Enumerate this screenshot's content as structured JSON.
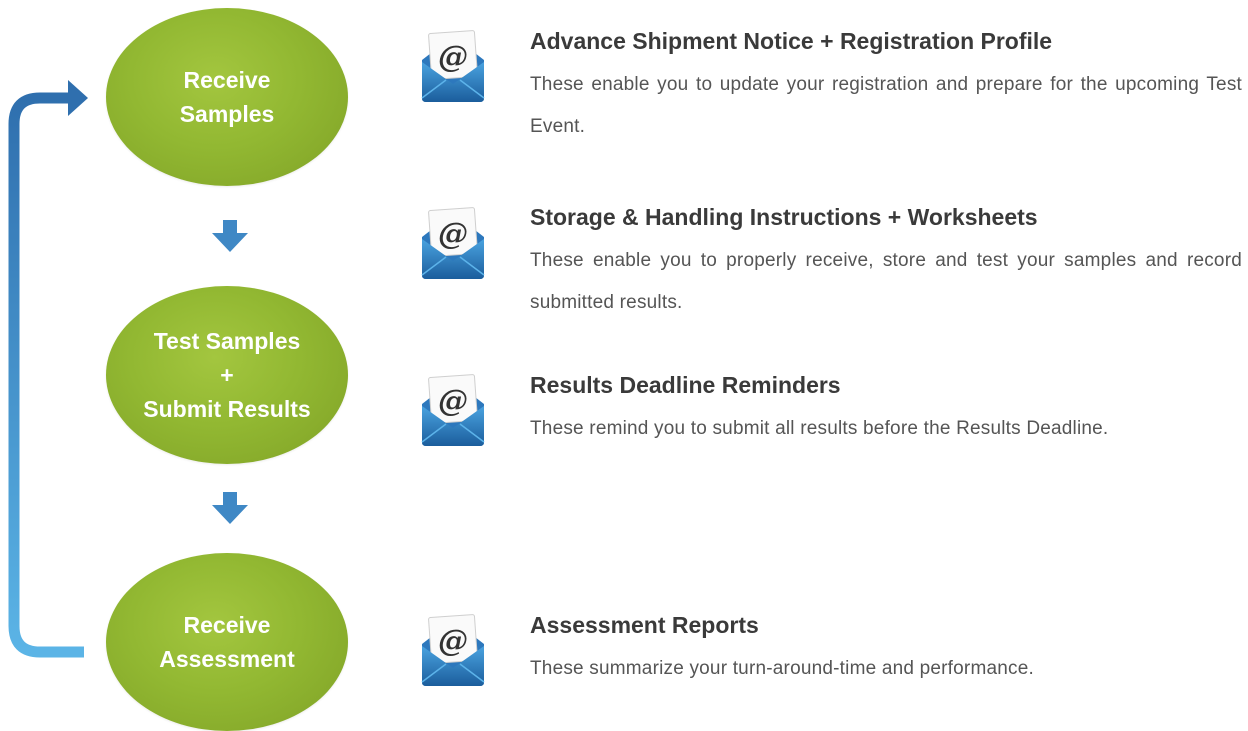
{
  "colors": {
    "circle_green": "#92b832",
    "arrow_blue": "#3f88c5",
    "heading_text": "#3a3a3a",
    "body_text": "#555555"
  },
  "stages": [
    {
      "lines": [
        "Receive",
        "Samples"
      ]
    },
    {
      "lines": [
        "Test Samples",
        "+",
        "Submit Results"
      ]
    },
    {
      "lines": [
        "Receive",
        "Assessment"
      ]
    }
  ],
  "notifications": [
    {
      "icon": "email-icon",
      "title": "Advance Shipment Notice + Registration Profile",
      "description": "These enable you to update your registration and prepare for the upcoming Test Event."
    },
    {
      "icon": "email-icon",
      "title": "Storage & Handling Instructions + Worksheets",
      "description": "These enable you to properly receive, store and test your samples and record submitted results."
    },
    {
      "icon": "email-icon",
      "title": "Results Deadline Reminders",
      "description": "These remind you to submit all results before the Results Deadline."
    },
    {
      "icon": "email-icon",
      "title": "Assessment Reports",
      "description": "These summarize your turn-around-time and performance."
    }
  ]
}
